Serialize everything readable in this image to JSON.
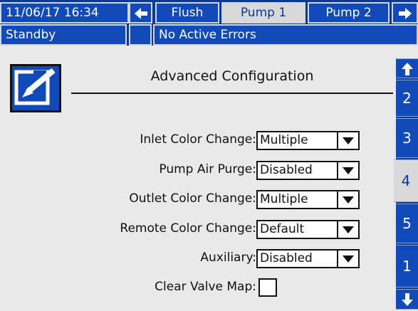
{
  "header": {
    "datetime": "11/06/17 16:34",
    "tabs": [
      {
        "label": "Flush",
        "active": false
      },
      {
        "label": "Pump 1",
        "active": true
      },
      {
        "label": "Pump 2",
        "active": false
      }
    ],
    "status": "Standby",
    "errors": "No Active Errors"
  },
  "page": {
    "title": "Advanced Configuration"
  },
  "fields": {
    "inlet_color_change": {
      "label": "Inlet Color Change:",
      "value": "Multiple"
    },
    "pump_air_purge": {
      "label": "Pump Air Purge:",
      "value": "Disabled"
    },
    "outlet_color_change": {
      "label": "Outlet Color Change:",
      "value": "Multiple"
    },
    "remote_color_change": {
      "label": "Remote Color Change:",
      "value": "Default"
    },
    "auxiliary": {
      "label": "Auxiliary:",
      "value": "Disabled"
    },
    "clear_valve_map": {
      "label": "Clear Valve Map:",
      "checked": false
    }
  },
  "sidebar": {
    "tabs": [
      "2",
      "3",
      "4",
      "5",
      "1"
    ],
    "active": "4"
  },
  "colors": {
    "header_bg": "#0d3a8e",
    "cell_bg": "#1149b8",
    "active_bg": "#d9d9d9",
    "page_bg": "#e9e9e9"
  }
}
